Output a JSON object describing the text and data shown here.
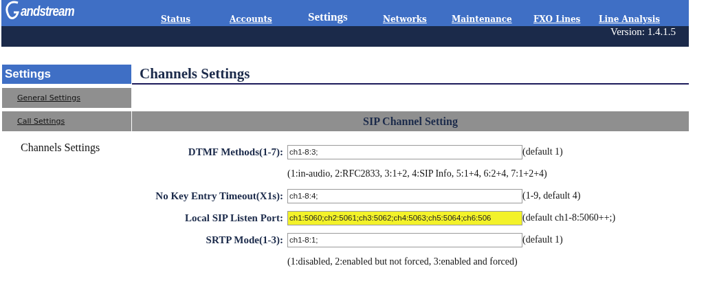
{
  "header": {
    "logo": "andstream",
    "nav": [
      {
        "label": "Status",
        "selected": false
      },
      {
        "label": "Accounts",
        "selected": false
      },
      {
        "label": "Settings",
        "selected": true
      },
      {
        "label": "Networks",
        "selected": false
      },
      {
        "label": "Maintenance",
        "selected": false
      },
      {
        "label": "FXO Lines",
        "selected": false
      },
      {
        "label": "Line Analysis",
        "selected": false
      }
    ],
    "version": "Version: 1.4.1.5"
  },
  "sidebar": {
    "title": "Settings",
    "items": [
      {
        "label": "General Settings",
        "selected": false
      },
      {
        "label": "Call Settings",
        "selected": false
      },
      {
        "label": "Channels Settings",
        "selected": true
      }
    ]
  },
  "page_title": "Channels Settings",
  "section": {
    "title": "SIP Channel Setting",
    "fields": [
      {
        "label": "DTMF Methods(1-7):",
        "value": "ch1-8:3;",
        "hint": "(default 1)",
        "note": "(1:in-audio, 2:RFC2833, 3:1+2, 4:SIP Info, 5:1+4, 6:2+4, 7:1+2+4)",
        "highlighted": false
      },
      {
        "label": "No Key Entry Timeout(X1s):",
        "value": "ch1-8:4;",
        "hint": "(1-9, default 4)",
        "highlighted": false
      },
      {
        "label": "Local SIP Listen Port:",
        "value": "ch1:5060;ch2:5061;ch3:5062;ch4:5063;ch5:5064;ch6:506",
        "hint": "(default ch1-8:5060++;)",
        "highlighted": true
      },
      {
        "label": "SRTP Mode(1-3):",
        "value": "ch1-8:1;",
        "hint": "(default 1)",
        "note": "(1:disabled, 2:enabled but not forced, 3:enabled and forced)",
        "highlighted": false
      }
    ]
  }
}
